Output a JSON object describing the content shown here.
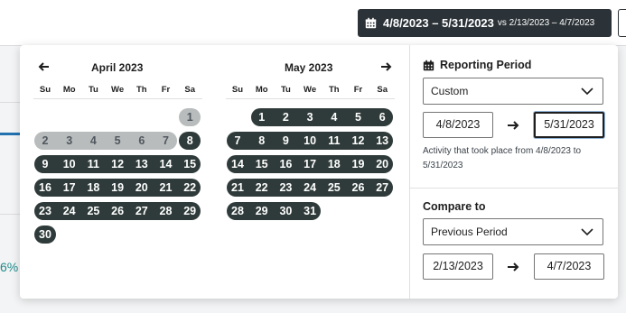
{
  "header": {
    "range_main": "4/8/2023 – 5/31/2023",
    "range_vs": "vs 2/13/2023 – 4/7/2023"
  },
  "background": {
    "percent_fragment": "6%"
  },
  "calendar": {
    "prev_icon": "arrow-left-icon",
    "next_icon": "arrow-right-icon",
    "weekdays": [
      "Su",
      "Mo",
      "Tu",
      "We",
      "Th",
      "Fr",
      "Sa"
    ],
    "months": [
      {
        "title": "April 2023",
        "first_weekday": 6,
        "days": 30,
        "grey_until": 7
      },
      {
        "title": "May 2023",
        "first_weekday": 1,
        "days": 31,
        "grey_until": 0
      }
    ]
  },
  "reporting": {
    "title": "Reporting Period",
    "icon": "calendar-icon",
    "period_value": "Custom",
    "start": "4/8/2023",
    "end": "5/31/2023",
    "hint": "Activity that took place from 4/8/2023 to 5/31/2023"
  },
  "compare": {
    "title": "Compare to",
    "value": "Previous Period",
    "start": "2/13/2023",
    "end": "4/7/2023"
  },
  "colors": {
    "selected": "#2f3b3a",
    "compare": "#b8bcbc",
    "button": "#2c3338"
  }
}
